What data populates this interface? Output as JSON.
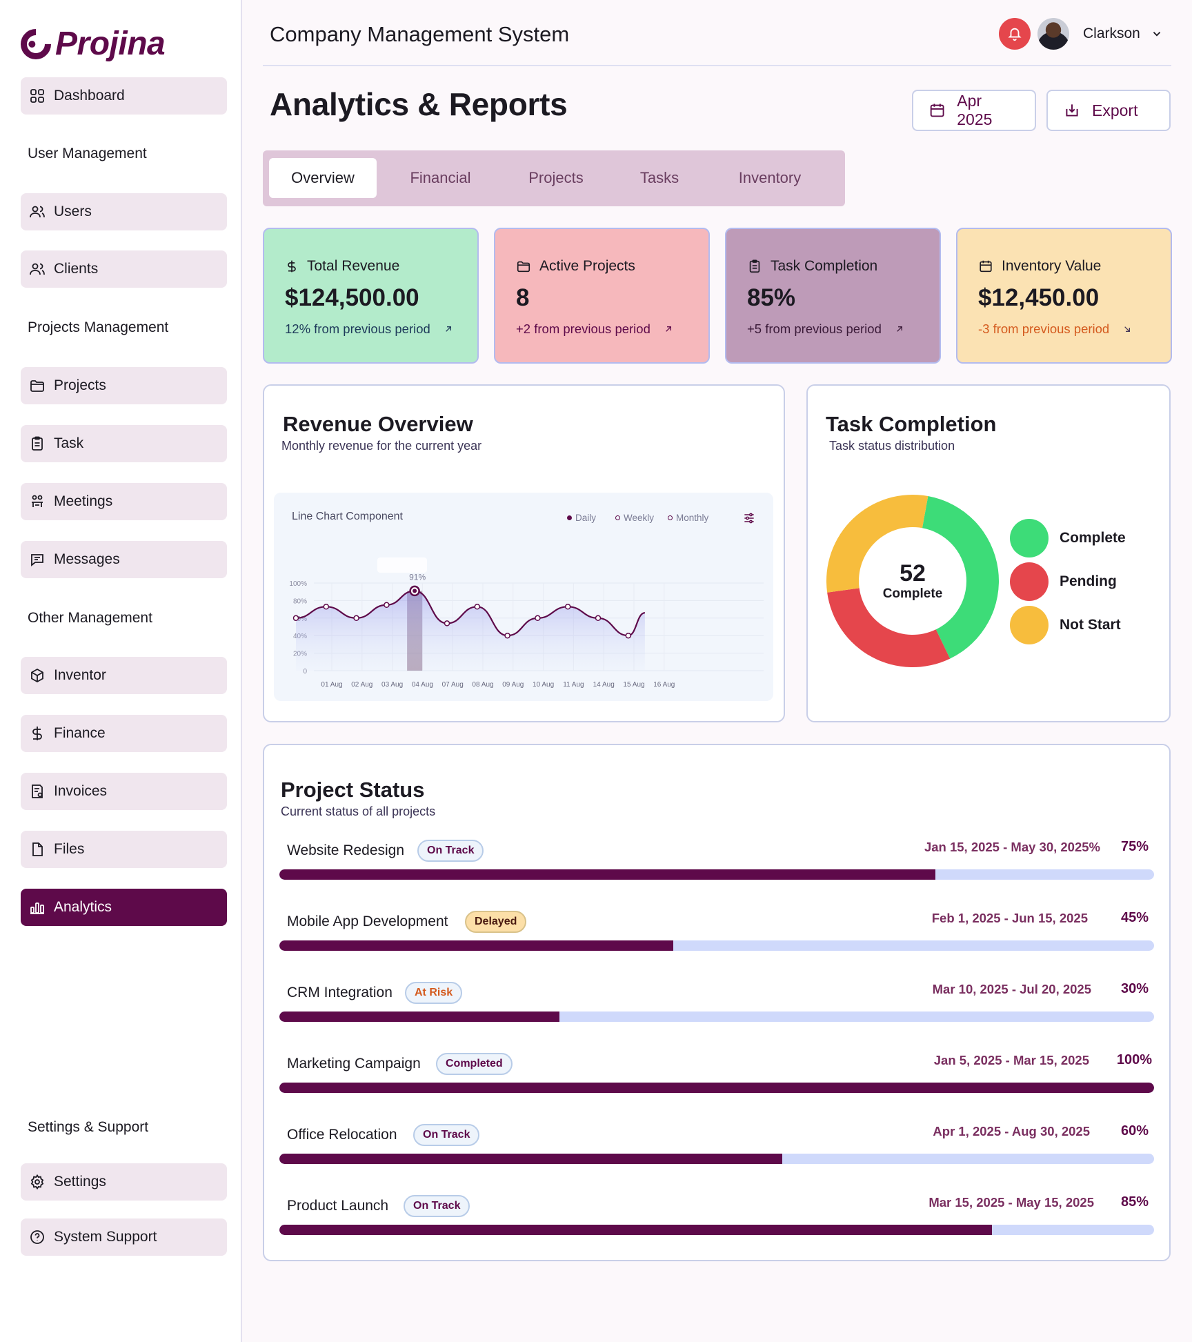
{
  "brand": {
    "logo_text": "Projina",
    "color": "#5e0a4a"
  },
  "sidebar": {
    "items": [
      {
        "label": "Dashboard",
        "icon": "grid-icon"
      },
      {
        "label": "Users",
        "icon": "users-icon"
      },
      {
        "label": "Clients",
        "icon": "clients-icon"
      },
      {
        "label": "Projects",
        "icon": "folder-icon"
      },
      {
        "label": "Task",
        "icon": "clipboard-icon"
      },
      {
        "label": "Meetings",
        "icon": "meetings-icon"
      },
      {
        "label": "Messages",
        "icon": "message-icon"
      },
      {
        "label": "Inventor",
        "icon": "box-icon"
      },
      {
        "label": "Finance",
        "icon": "dollar-icon"
      },
      {
        "label": "Invoices",
        "icon": "invoice-icon"
      },
      {
        "label": "Files",
        "icon": "file-icon"
      },
      {
        "label": "Analytics",
        "icon": "bar-chart-icon",
        "active": true
      },
      {
        "label": "Settings",
        "icon": "gear-icon"
      },
      {
        "label": "System Support",
        "icon": "help-icon"
      }
    ],
    "sections": {
      "user_mgmt": "User Management",
      "projects_mgmt": "Projects Management",
      "other_mgmt": "Other Management",
      "settings_support": "Settings & Support"
    }
  },
  "header": {
    "app_title": "Company Management System",
    "user_name": "Clarkson",
    "notification_color": "#e5464c"
  },
  "page": {
    "title": "Analytics & Reports",
    "date_button": "Apr 2025",
    "export_button": "Export"
  },
  "tabs": [
    {
      "label": "Overview",
      "active": true
    },
    {
      "label": "Financial"
    },
    {
      "label": "Projects"
    },
    {
      "label": "Tasks"
    },
    {
      "label": "Inventory"
    }
  ],
  "stats": [
    {
      "label": "Total Revenue",
      "value": "$124,500.00",
      "change": "12% from previous period",
      "trend": "up",
      "bg": "#b3ebcb"
    },
    {
      "label": "Active Projects",
      "value": "8",
      "change": "+2 from previous period",
      "trend": "up",
      "bg": "#f6b8bc"
    },
    {
      "label": "Task Completion",
      "value": "85%",
      "change": "+5 from previous period",
      "trend": "up",
      "bg": "#be9bb8"
    },
    {
      "label": "Inventory Value",
      "value": "$12,450.00",
      "change": "-3 from previous period",
      "trend": "down",
      "bg": "#fbe2b3",
      "change_color": "#d45a1e"
    }
  ],
  "revenue": {
    "title": "Revenue Overview",
    "subtitle": "Monthly revenue for the current year",
    "component_label": "Line Chart Component",
    "legend": [
      "Daily",
      "Weekly",
      "Monthly"
    ]
  },
  "chart_data": {
    "type": "line",
    "x": [
      "01 Aug",
      "02 Aug",
      "03 Aug",
      "04 Aug",
      "07 Aug",
      "08 Aug",
      "09 Aug",
      "10 Aug",
      "11 Aug",
      "14 Aug",
      "15 Aug",
      "16 Aug"
    ],
    "y_ticks": [
      "0",
      "20%",
      "40%",
      "60%",
      "80%",
      "100%"
    ],
    "ylim": [
      0,
      100
    ],
    "series": [
      {
        "name": "Daily",
        "values": [
          60,
          73,
          60,
          75,
          91,
          54,
          73,
          40,
          60,
          73,
          60,
          40,
          66
        ]
      }
    ],
    "x_positions": [
      0,
      1,
      2,
      3,
      3.93,
      5,
      6,
      7,
      8,
      9,
      10,
      11,
      11.55
    ],
    "highlight": {
      "label": "91%",
      "value": 91,
      "index": 4
    }
  },
  "task_completion": {
    "title": "Task Completion",
    "subtitle": "Task status distribution",
    "center_value": "52",
    "center_label": "Complete",
    "segments": [
      {
        "label": "Complete",
        "value": 40,
        "color": "#3ddc78"
      },
      {
        "label": "Pending",
        "value": 30,
        "color": "#e5464c"
      },
      {
        "label": "Not Start",
        "value": 30,
        "color": "#f7bd3d"
      }
    ]
  },
  "project_status": {
    "title": "Project Status",
    "subtitle": "Current status of all projects",
    "projects": [
      {
        "name": "Website Redesign",
        "status": "On Track",
        "status_kind": "track",
        "dates": "Jan 15, 2025 - May 30, 2025%",
        "percent_label": "75%",
        "progress": 75
      },
      {
        "name": "Mobile App Development",
        "status": "Delayed",
        "status_kind": "delayed",
        "dates": "Feb 1, 2025 - Jun 15, 2025",
        "percent_label": "45%",
        "progress": 45
      },
      {
        "name": "CRM Integration",
        "status": "At Risk",
        "status_kind": "risk",
        "dates": "Mar 10, 2025 - Jul 20, 2025",
        "percent_label": "30%",
        "progress": 32
      },
      {
        "name": "Marketing Campaign",
        "status": "Completed",
        "status_kind": "track",
        "dates": "Jan 5, 2025 - Mar 15, 2025",
        "percent_label": "100%",
        "progress": 100
      },
      {
        "name": "Office Relocation",
        "status": "On Track",
        "status_kind": "track",
        "dates": "Apr 1, 2025 - Aug 30, 2025",
        "percent_label": "60%",
        "progress": 57.5
      },
      {
        "name": "Product Launch",
        "status": "On Track",
        "status_kind": "track",
        "dates": "Mar 15, 2025 - May 15, 2025",
        "percent_label": "85%",
        "progress": 81.5
      }
    ]
  }
}
